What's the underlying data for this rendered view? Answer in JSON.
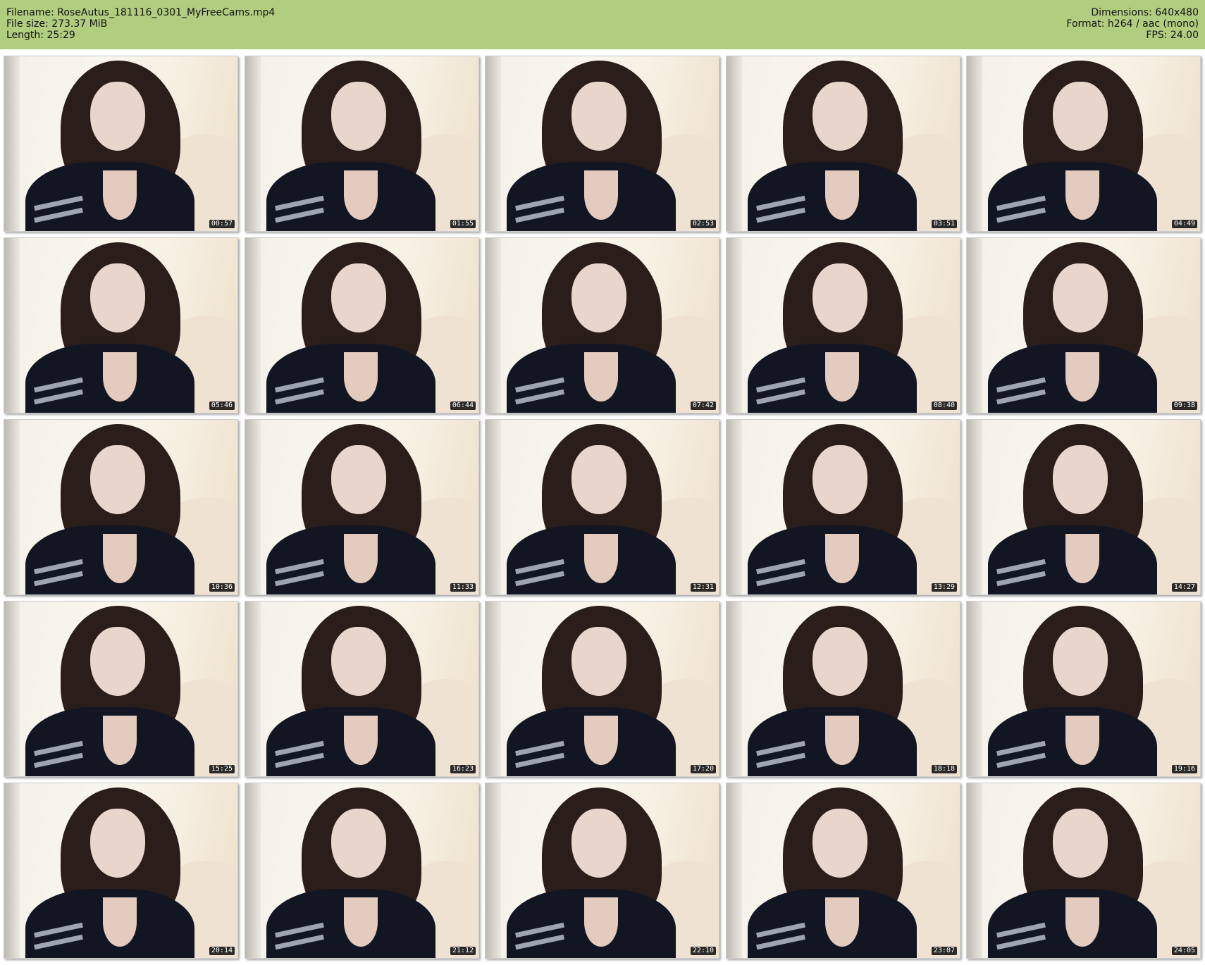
{
  "header": {
    "left": [
      "Filename: RoseAutus_181116_0301_MyFreeCams.mp4",
      "File size: 273.37 MiB",
      "Length: 25:29"
    ],
    "right": [
      "Dimensions: 640x480",
      "Format: h264 / aac (mono)",
      "FPS: 24.00"
    ]
  },
  "thumbnails": [
    "00:57",
    "01:55",
    "02:53",
    "03:51",
    "04:49",
    "05:46",
    "06:44",
    "07:42",
    "08:40",
    "09:38",
    "10:36",
    "11:33",
    "12:31",
    "13:29",
    "14:27",
    "15:25",
    "16:23",
    "17:20",
    "18:18",
    "19:16",
    "20:14",
    "21:12",
    "22:10",
    "23:07",
    "24:05"
  ]
}
